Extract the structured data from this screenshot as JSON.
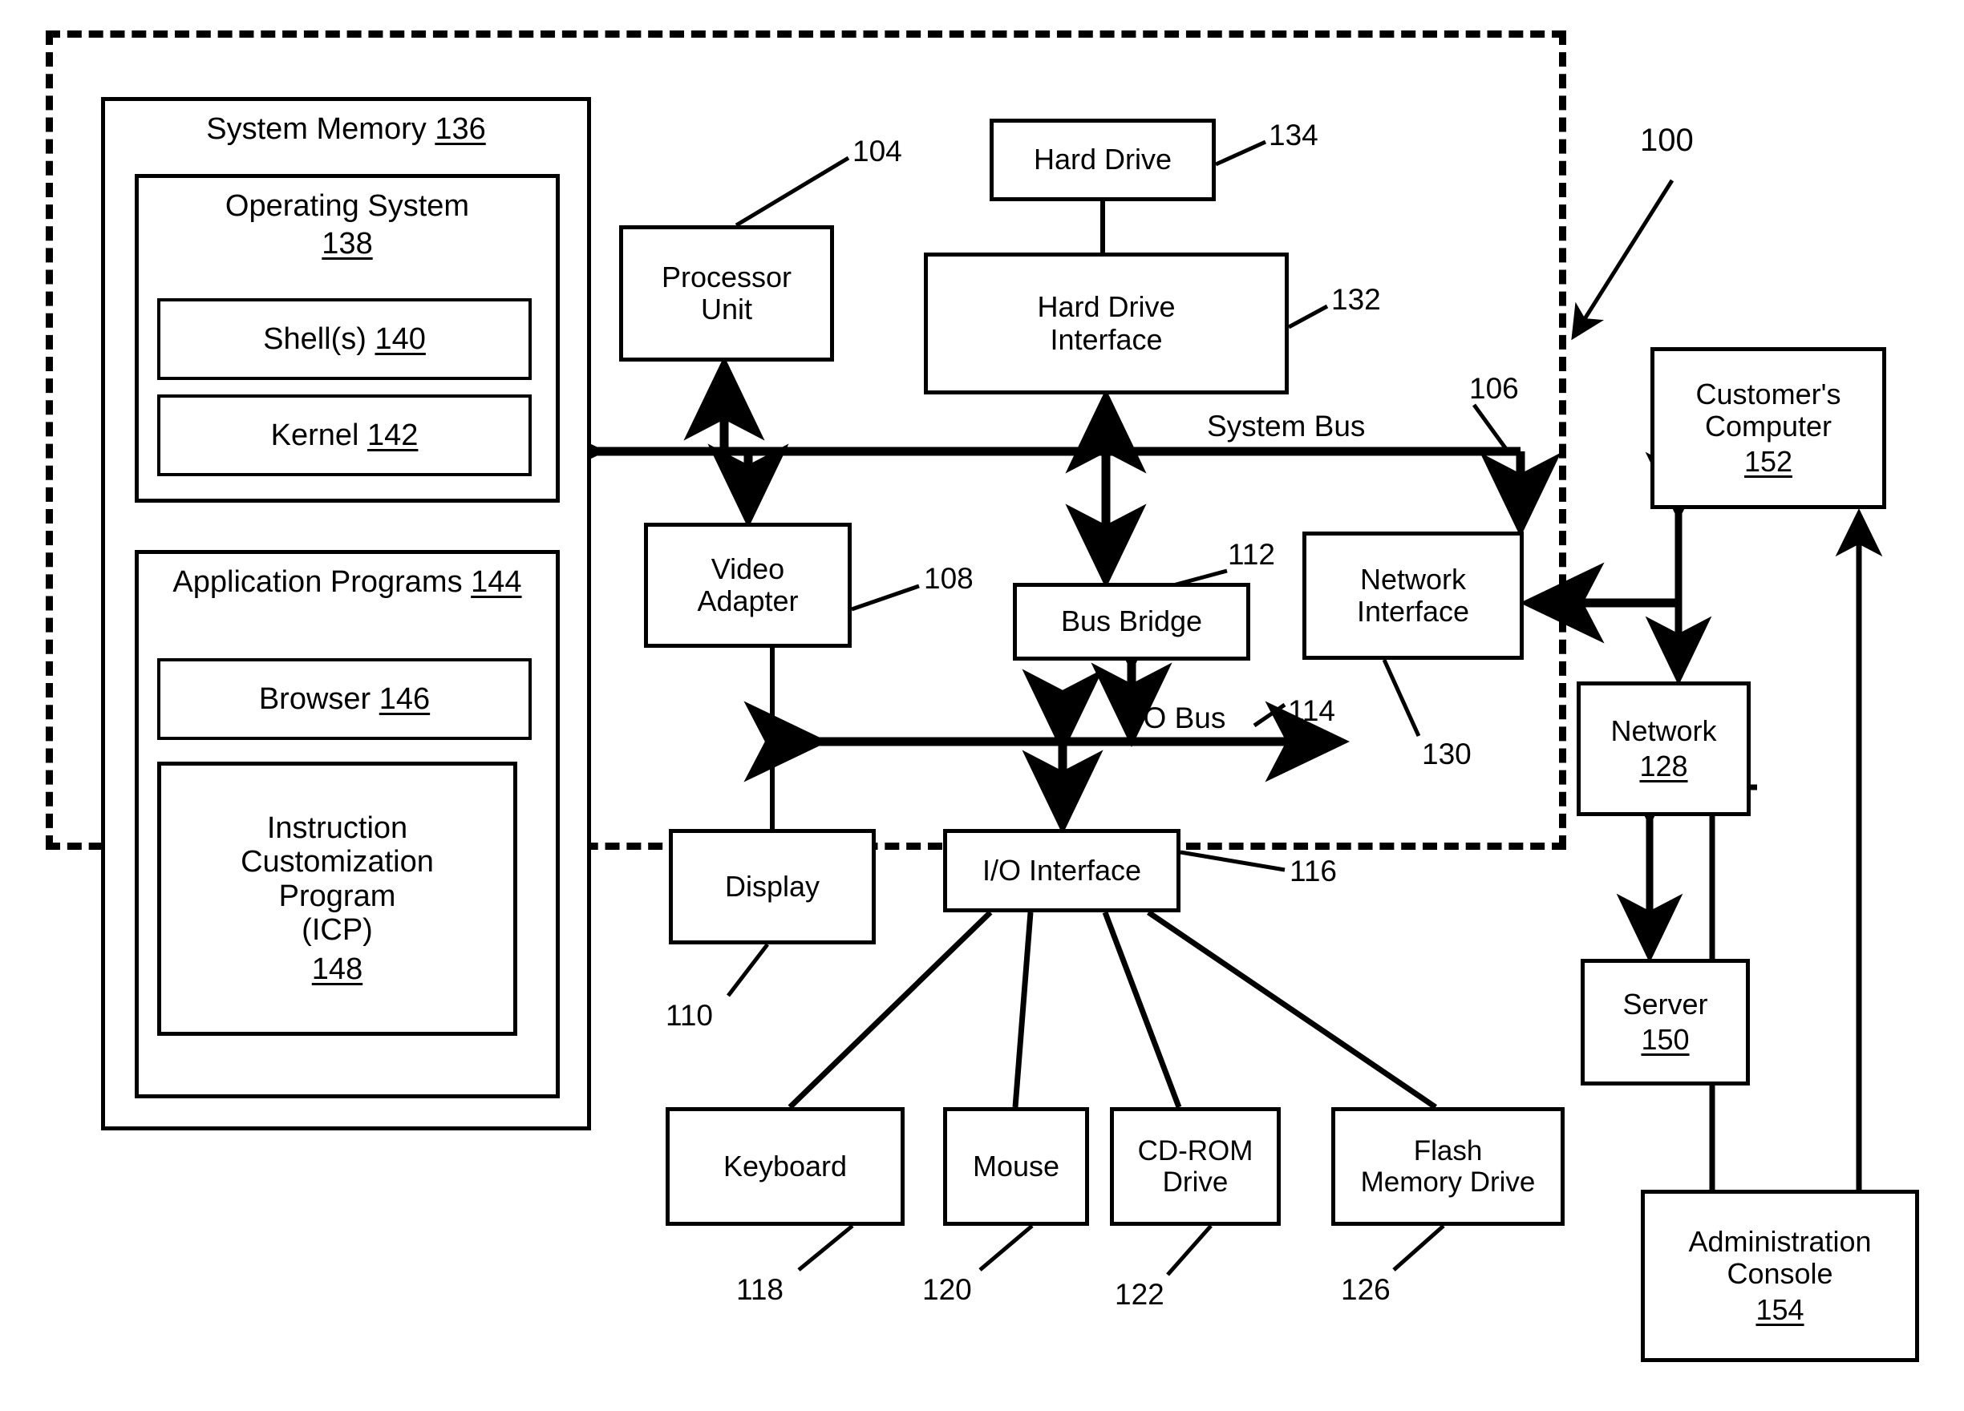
{
  "figure": {
    "reference_numeral": "100",
    "system_bus_label": "System Bus",
    "system_bus_numeral": "106",
    "io_bus_label": "I/O Bus",
    "io_bus_numeral": "114"
  },
  "memory": {
    "title": "System Memory",
    "numeral": "136",
    "os": {
      "title": "Operating System",
      "numeral": "138",
      "shell": {
        "label": "Shell(s)",
        "numeral": "140"
      },
      "kernel": {
        "label": "Kernel",
        "numeral": "142"
      }
    },
    "apps": {
      "title": "Application Programs",
      "numeral": "144",
      "browser": {
        "label": "Browser",
        "numeral": "146"
      },
      "icp": {
        "line1": "Instruction",
        "line2": "Customization",
        "line3": "Program",
        "line4": "(ICP)",
        "numeral": "148"
      }
    }
  },
  "blocks": {
    "processor": {
      "line1": "Processor",
      "line2": "Unit",
      "numeral": "104"
    },
    "hard_drive": {
      "label": "Hard Drive",
      "numeral": "134"
    },
    "hard_drive_interface": {
      "line1": "Hard Drive",
      "line2": "Interface",
      "numeral": "132"
    },
    "video_adapter": {
      "line1": "Video",
      "line2": "Adapter",
      "numeral": "108"
    },
    "bus_bridge": {
      "label": "Bus Bridge",
      "numeral": "112"
    },
    "network_interface": {
      "line1": "Network",
      "line2": "Interface",
      "numeral": "130"
    },
    "display": {
      "label": "Display",
      "numeral": "110"
    },
    "io_interface": {
      "label": "I/O Interface",
      "numeral": "116"
    },
    "keyboard": {
      "label": "Keyboard",
      "numeral": "118"
    },
    "mouse": {
      "label": "Mouse",
      "numeral": "120"
    },
    "cdrom": {
      "line1": "CD-ROM",
      "line2": "Drive",
      "numeral": "122"
    },
    "flash": {
      "line1": "Flash",
      "line2": "Memory Drive",
      "numeral": "126"
    },
    "customers_computer": {
      "line1": "Customer's",
      "line2": "Computer",
      "numeral": "152"
    },
    "network": {
      "label": "Network",
      "numeral": "128"
    },
    "server": {
      "label": "Server",
      "numeral": "150"
    },
    "admin_console": {
      "line1": "Administration",
      "line2": "Console",
      "numeral": "154"
    }
  }
}
